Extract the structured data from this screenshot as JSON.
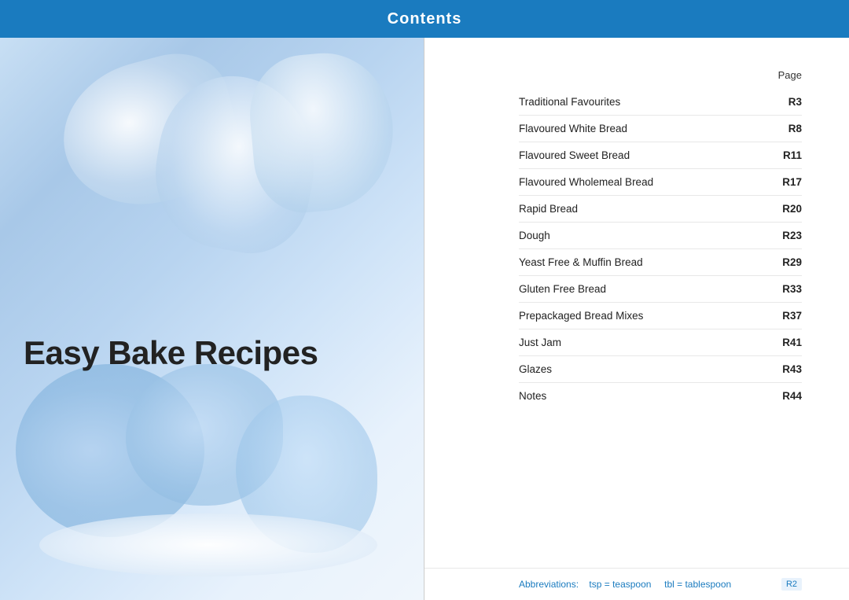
{
  "header": {
    "title": "Contents",
    "bg_color": "#1a7bbf"
  },
  "left_panel": {
    "title": "Easy Bake Recipes"
  },
  "right_panel": {
    "page_label": "Page",
    "toc": [
      {
        "name": "Traditional Favourites",
        "page": "R3"
      },
      {
        "name": "Flavoured White Bread",
        "page": "R8"
      },
      {
        "name": "Flavoured Sweet Bread",
        "page": "R11"
      },
      {
        "name": "Flavoured Wholemeal Bread",
        "page": "R17"
      },
      {
        "name": "Rapid Bread",
        "page": "R20"
      },
      {
        "name": "Dough",
        "page": "R23"
      },
      {
        "name": "Yeast Free & Muffin Bread",
        "page": "R29"
      },
      {
        "name": "Gluten Free Bread",
        "page": "R33"
      },
      {
        "name": "Prepackaged Bread Mixes",
        "page": "R37"
      },
      {
        "name": "Just Jam",
        "page": "R41"
      },
      {
        "name": "Glazes",
        "page": "R43"
      },
      {
        "name": "Notes",
        "page": "R44"
      }
    ],
    "footer": {
      "abbreviations_label": "Abbreviations:",
      "tsp_label": "tsp = teaspoon",
      "tbl_label": "tbl = tablespoon",
      "page_number": "R2"
    }
  }
}
